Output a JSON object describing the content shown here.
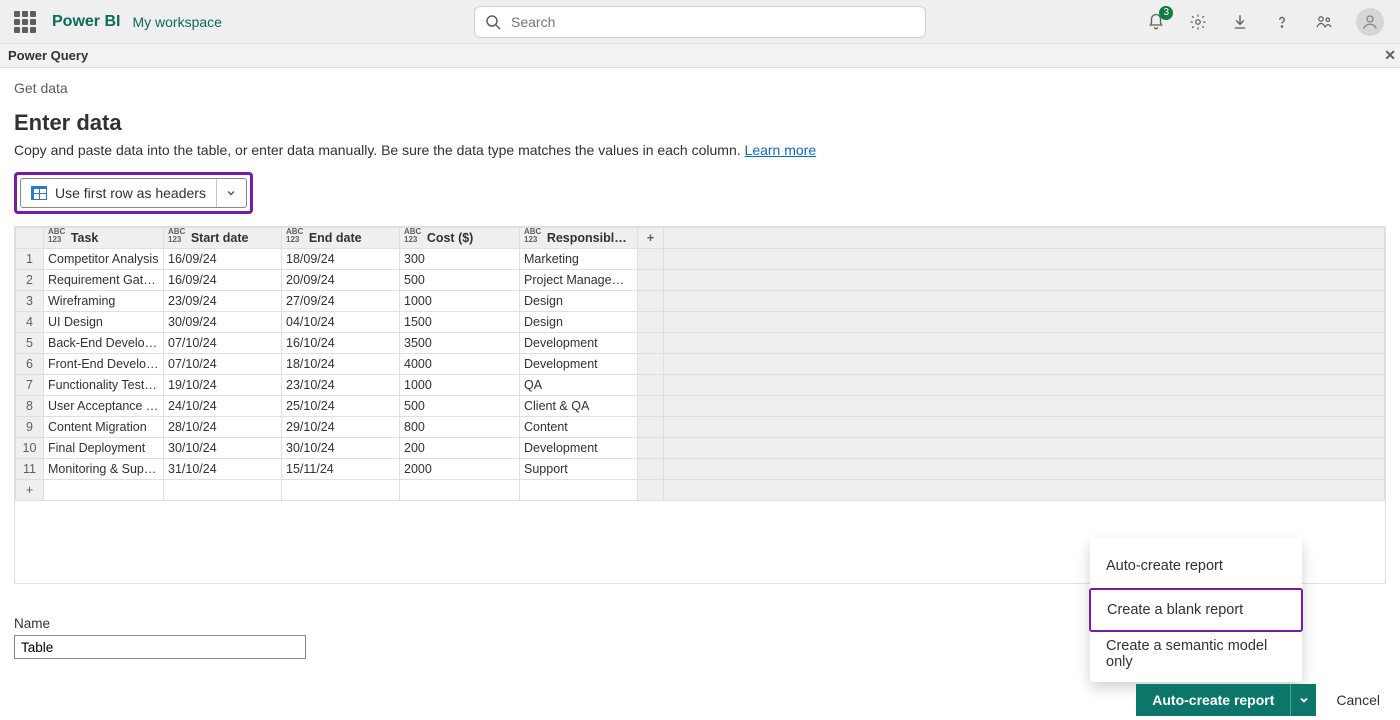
{
  "appbar": {
    "brand": "Power BI",
    "workspace": "My workspace",
    "search_placeholder": "Search",
    "notification_count": "3"
  },
  "secondbar": {
    "title": "Power Query"
  },
  "breadcrumb": "Get data",
  "page": {
    "title": "Enter data",
    "subtitle_pre": "Copy and paste data into the table, or enter data manually. Be sure the data type matches the values in each column. ",
    "learn_more": "Learn more"
  },
  "header_button": {
    "label": "Use first row as headers"
  },
  "table": {
    "type_prefix_top": "ABC",
    "type_prefix_bot": "123",
    "columns": [
      "Task",
      "Start date",
      "End date",
      "Cost ($)",
      "Responsible Te…"
    ],
    "add_col": "+",
    "add_row": "+",
    "rows": [
      [
        "Competitor Analysis",
        "16/09/24",
        "18/09/24",
        "300",
        "Marketing"
      ],
      [
        "Requirement Gathe…",
        "16/09/24",
        "20/09/24",
        "500",
        "Project Management"
      ],
      [
        "Wireframing",
        "23/09/24",
        "27/09/24",
        "1000",
        "Design"
      ],
      [
        "UI Design",
        "30/09/24",
        "04/10/24",
        "1500",
        "Design"
      ],
      [
        "Back-End Develop…",
        "07/10/24",
        "16/10/24",
        "3500",
        "Development"
      ],
      [
        "Front-End Develop…",
        "07/10/24",
        "18/10/24",
        "4000",
        "Development"
      ],
      [
        "Functionality Testing",
        "19/10/24",
        "23/10/24",
        "1000",
        "QA"
      ],
      [
        "User Acceptance T…",
        "24/10/24",
        "25/10/24",
        "500",
        "Client & QA"
      ],
      [
        "Content Migration",
        "28/10/24",
        "29/10/24",
        "800",
        "Content"
      ],
      [
        "Final Deployment",
        "30/10/24",
        "30/10/24",
        "200",
        "Development"
      ],
      [
        "Monitoring & Support",
        "31/10/24",
        "15/11/24",
        "2000",
        "Support"
      ]
    ]
  },
  "name": {
    "label": "Name",
    "value": "Table"
  },
  "menu": {
    "items": [
      "Auto-create report",
      "Create a blank report",
      "Create a semantic model only"
    ],
    "highlight_index": 1
  },
  "footer": {
    "primary": "Auto-create report",
    "cancel": "Cancel"
  }
}
